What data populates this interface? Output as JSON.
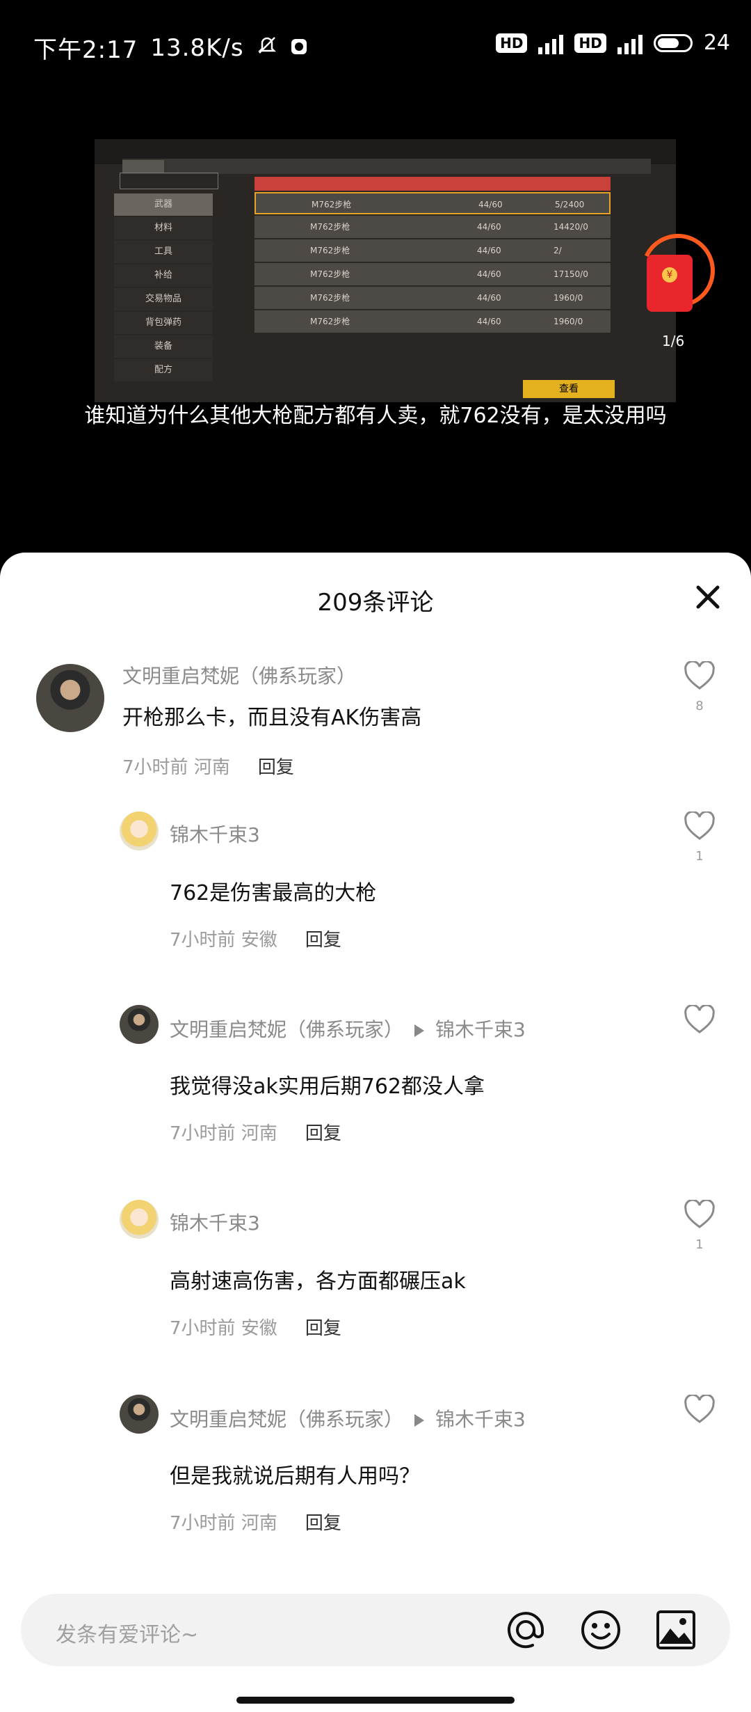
{
  "status_bar": {
    "time": "下午2:17",
    "speed": "13.8K/s",
    "hd1": "HD",
    "hd2": "HD",
    "battery_level": "24"
  },
  "video": {
    "subtitle": "谁知道为什么其他大枪配方都有人卖，就762没有，是太没用吗",
    "sidebar": [
      "武器",
      "材料",
      "工具",
      "补给",
      "交易物品",
      "背包弹药",
      "装备",
      "配方"
    ],
    "rows": [
      {
        "name": "M762步枪",
        "level": "44/60",
        "price": "5/2400"
      },
      {
        "name": "M762步枪",
        "level": "44/60",
        "price": "14420/0"
      },
      {
        "name": "M762步枪",
        "level": "44/60",
        "price": "2/"
      },
      {
        "name": "M762步枪",
        "level": "44/60",
        "price": "17150/0"
      },
      {
        "name": "M762步枪",
        "level": "44/60",
        "price": "1960/0"
      },
      {
        "name": "M762步枪",
        "level": "44/60",
        "price": "1960/0"
      }
    ],
    "buy_label": "查看",
    "red_packet_count": "1/6"
  },
  "comments_sheet": {
    "title": "209条评论",
    "comments": [
      {
        "user": "文明重启梵妮（佛系玩家）",
        "text": "开枪那么卡，而且没有AK伤害高",
        "time_loc": "7小时前 河南",
        "reply": "回复",
        "likes": "8"
      },
      {
        "user": "锦木千束3",
        "text": "762是伤害最高的大枪",
        "time_loc": "7小时前 安徽",
        "reply": "回复",
        "likes": "1"
      },
      {
        "user": "文明重启梵妮（佛系玩家）",
        "reply_to": "锦木千束3",
        "text": "我觉得没ak实用后期762都没人拿",
        "time_loc": "7小时前 河南",
        "reply": "回复",
        "likes": ""
      },
      {
        "user": "锦木千束3",
        "text": "高射速高伤害，各方面都碾压ak",
        "time_loc": "7小时前 安徽",
        "reply": "回复",
        "likes": "1"
      },
      {
        "user": "文明重启梵妮（佛系玩家）",
        "reply_to": "锦木千束3",
        "text": "但是我就说后期有人用吗？",
        "time_loc": "7小时前 河南",
        "reply": "回复",
        "likes": ""
      }
    ]
  },
  "input_bar": {
    "placeholder": "发条有爱评论~",
    "icons": [
      "at-icon",
      "emoji-icon",
      "image-icon"
    ]
  }
}
